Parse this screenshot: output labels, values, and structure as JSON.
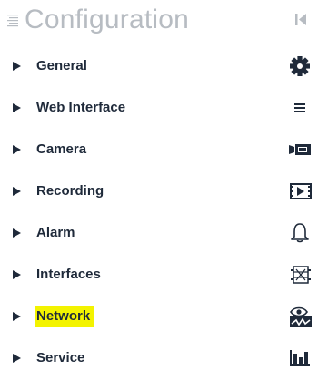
{
  "header": {
    "title": "Configuration",
    "menu_icon": "list-icon",
    "collapse_icon": "collapse-left-icon"
  },
  "colors": {
    "title": "#b7bcc2",
    "text": "#1f2a3a",
    "highlight": "#f3f300"
  },
  "nav": {
    "items": [
      {
        "label": "General",
        "icon": "gear-icon"
      },
      {
        "label": "Web Interface",
        "icon": "menu-lines-icon"
      },
      {
        "label": "Camera",
        "icon": "camera-icon"
      },
      {
        "label": "Recording",
        "icon": "film-play-icon"
      },
      {
        "label": "Alarm",
        "icon": "bell-icon"
      },
      {
        "label": "Interfaces",
        "icon": "interfaces-icon"
      },
      {
        "label": "Network",
        "icon": "network-eye-icon",
        "highlighted": true
      },
      {
        "label": "Service",
        "icon": "bar-chart-icon"
      }
    ]
  }
}
